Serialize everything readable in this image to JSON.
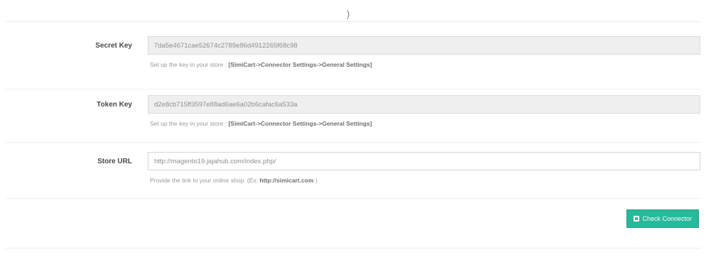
{
  "top_fragment": ")",
  "form": {
    "secret_key": {
      "label": "Secret Key",
      "value": "7da5e4671cae52674c2789e86d4912265f68c98",
      "help_prefix": "Set up the key in your store :",
      "help_bold": "[SimiCart->Connector Settings->General Settings]"
    },
    "token_key": {
      "label": "Token Key",
      "value": "d2e8cb715ff3597e88ad6ae6a02b6cafac6a533a",
      "help_prefix": "Set up the key in your store :",
      "help_bold": "[SimiCart->Connector Settings->General Settings]"
    },
    "store_url": {
      "label": "Store URL",
      "value": "http://magento19.jajahub.com/index.php/",
      "help_prefix": "Provide the link to your online shop. (Ex:",
      "help_bold": "http://simicart.com",
      "help_suffix": ")"
    },
    "button": {
      "label": "Check Connector"
    }
  }
}
